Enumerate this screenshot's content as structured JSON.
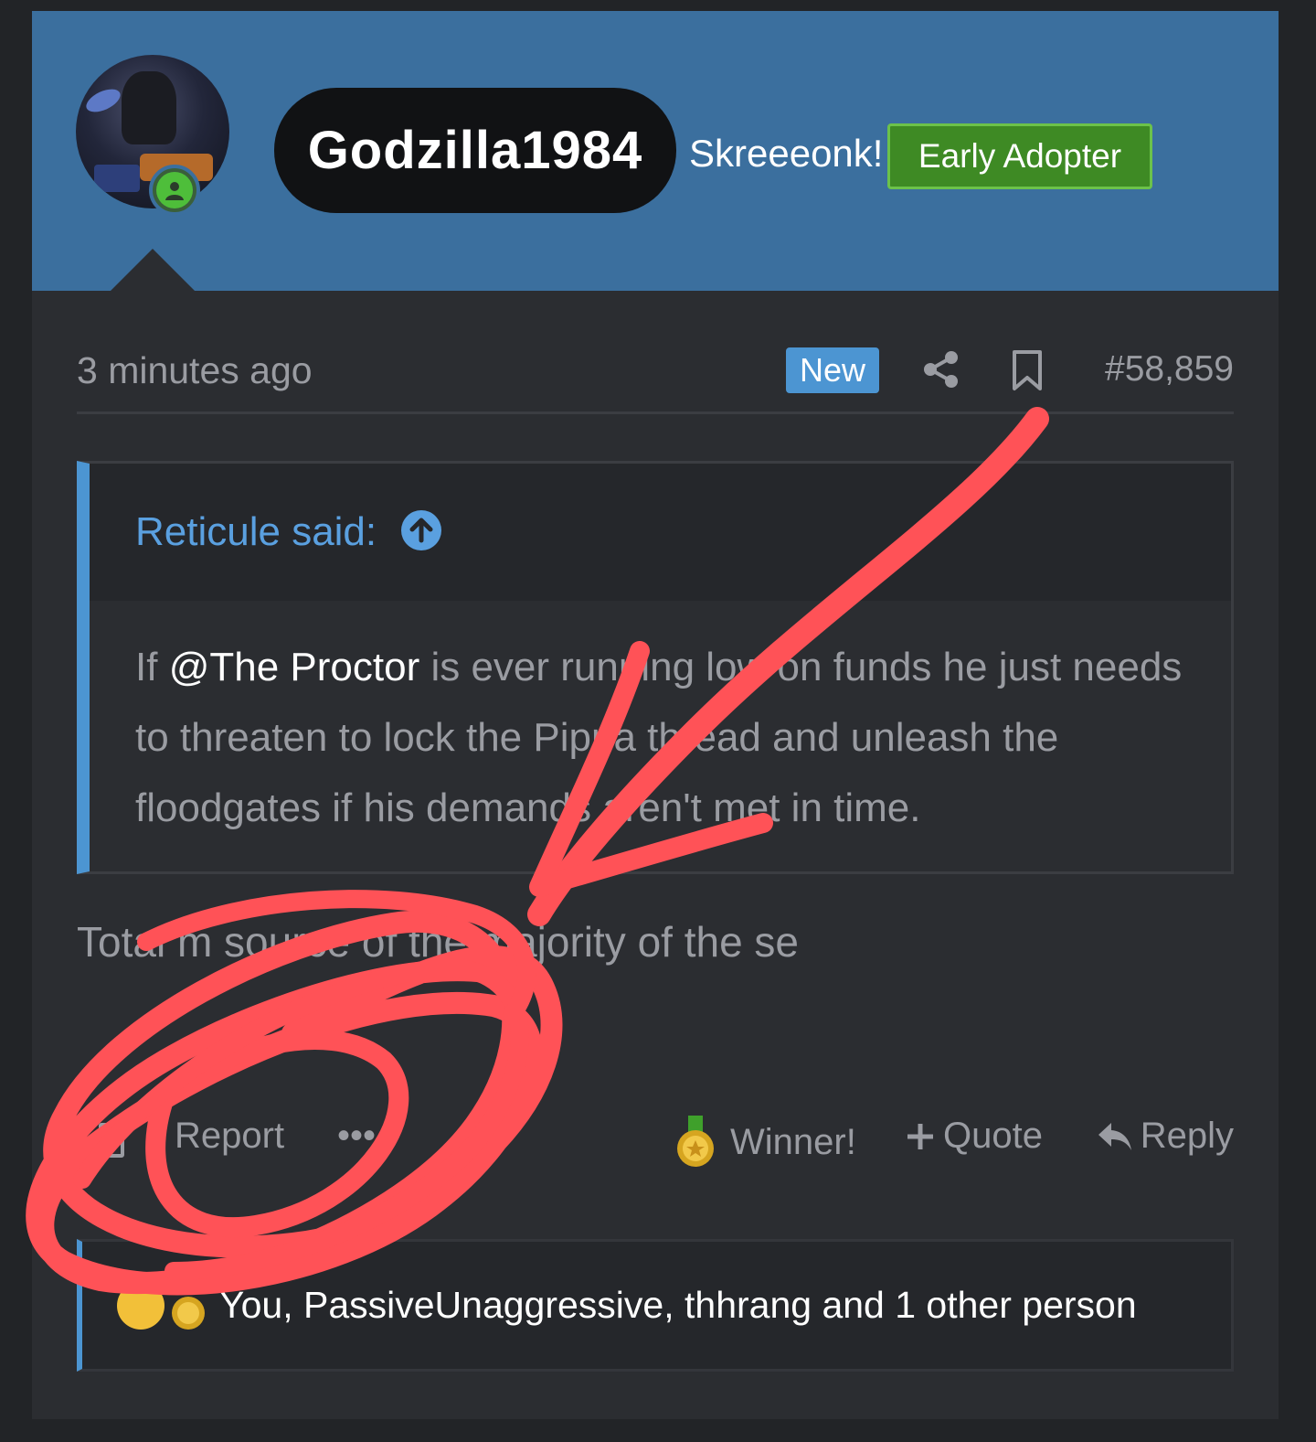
{
  "post": {
    "author": {
      "username": "Godzilla1984",
      "user_title": "Skreeeonk!",
      "banner": "Early Adopter",
      "online": true
    },
    "meta": {
      "time": "3 minutes ago",
      "new_label": "New",
      "post_number": "#58,859"
    },
    "quote": {
      "attribution": "Reticule said:",
      "text_before": "If ",
      "mention": "@The Proctor",
      "text_after": " is ever running low on funds he just needs to threaten to lock the Pippa thread and unleash the floodgates if his demands aren't met in time."
    },
    "body": "Total m                     source of the majority of the se",
    "actions": {
      "report": "Report",
      "more": "•••",
      "winner": "Winner!",
      "quote": "Quote",
      "reply": "Reply"
    },
    "reactions": {
      "summary": "You, PassiveUnaggressive, thhrang and 1 other person"
    }
  },
  "colors": {
    "header": "#3b6f9e",
    "accent": "#4c95d2",
    "banner": "#3e8a24",
    "annotation": "#ff5257"
  },
  "icons": [
    "share-icon",
    "bookmark-icon",
    "arrow-up-circle-icon",
    "checkbox-icon",
    "medal-icon",
    "plus-icon",
    "reply-arrow-icon"
  ]
}
